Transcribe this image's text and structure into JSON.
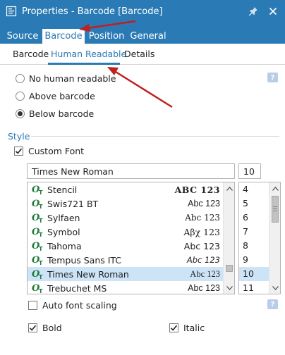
{
  "window": {
    "title": "Properties - Barcode [Barcode]"
  },
  "main_tabs": [
    {
      "label": "Source",
      "active": false
    },
    {
      "label": "Barcode",
      "active": true
    },
    {
      "label": "Position",
      "active": false
    },
    {
      "label": "General",
      "active": false
    }
  ],
  "sub_tabs": [
    {
      "label": "Barcode",
      "active": false
    },
    {
      "label": "Human Readable",
      "active": true
    },
    {
      "label": "Details",
      "active": false
    }
  ],
  "placement": {
    "options": [
      {
        "label": "No human readable",
        "selected": false
      },
      {
        "label": "Above barcode",
        "selected": false
      },
      {
        "label": "Below barcode",
        "selected": true
      }
    ]
  },
  "style": {
    "section_label": "Style",
    "custom_font": {
      "label": "Custom Font",
      "checked": true
    },
    "font_input_value": "Times New Roman",
    "size_input_value": "10",
    "fonts": [
      {
        "name": "Stencil",
        "sample": "ABC 123",
        "selected": false
      },
      {
        "name": "Swis721 BT",
        "sample": "Abc 123",
        "selected": false
      },
      {
        "name": "Sylfaen",
        "sample": "Abc 123",
        "selected": false
      },
      {
        "name": "Symbol",
        "sample": "Αβχ 123",
        "selected": false
      },
      {
        "name": "Tahoma",
        "sample": "Abc 123",
        "selected": false
      },
      {
        "name": "Tempus Sans ITC",
        "sample": "Abc 123",
        "selected": false
      },
      {
        "name": "Times New Roman",
        "sample": "Abc 123",
        "selected": true
      },
      {
        "name": "Trebuchet MS",
        "sample": "Abc 123",
        "selected": false
      }
    ],
    "sizes": [
      {
        "value": "4",
        "selected": false
      },
      {
        "value": "5",
        "selected": false
      },
      {
        "value": "6",
        "selected": false
      },
      {
        "value": "7",
        "selected": false
      },
      {
        "value": "8",
        "selected": false
      },
      {
        "value": "9",
        "selected": false
      },
      {
        "value": "10",
        "selected": true
      },
      {
        "value": "11",
        "selected": false
      }
    ],
    "auto_font_scaling": {
      "label": "Auto font scaling",
      "checked": false
    },
    "bold": {
      "label": "Bold",
      "checked": true
    },
    "italic": {
      "label": "Italic",
      "checked": true
    }
  },
  "colors": {
    "accent": "#2a7ab5",
    "selection": "#cde4f7",
    "annotation_arrow": "#c0201f",
    "ot_icon": "#1f7a3a"
  },
  "icons": {
    "window": "properties-window-icon",
    "pin": "pin-icon",
    "close": "close-icon",
    "help": "help-icon",
    "font_type": "opentype-font-icon",
    "checkmark": "checkmark-icon"
  }
}
